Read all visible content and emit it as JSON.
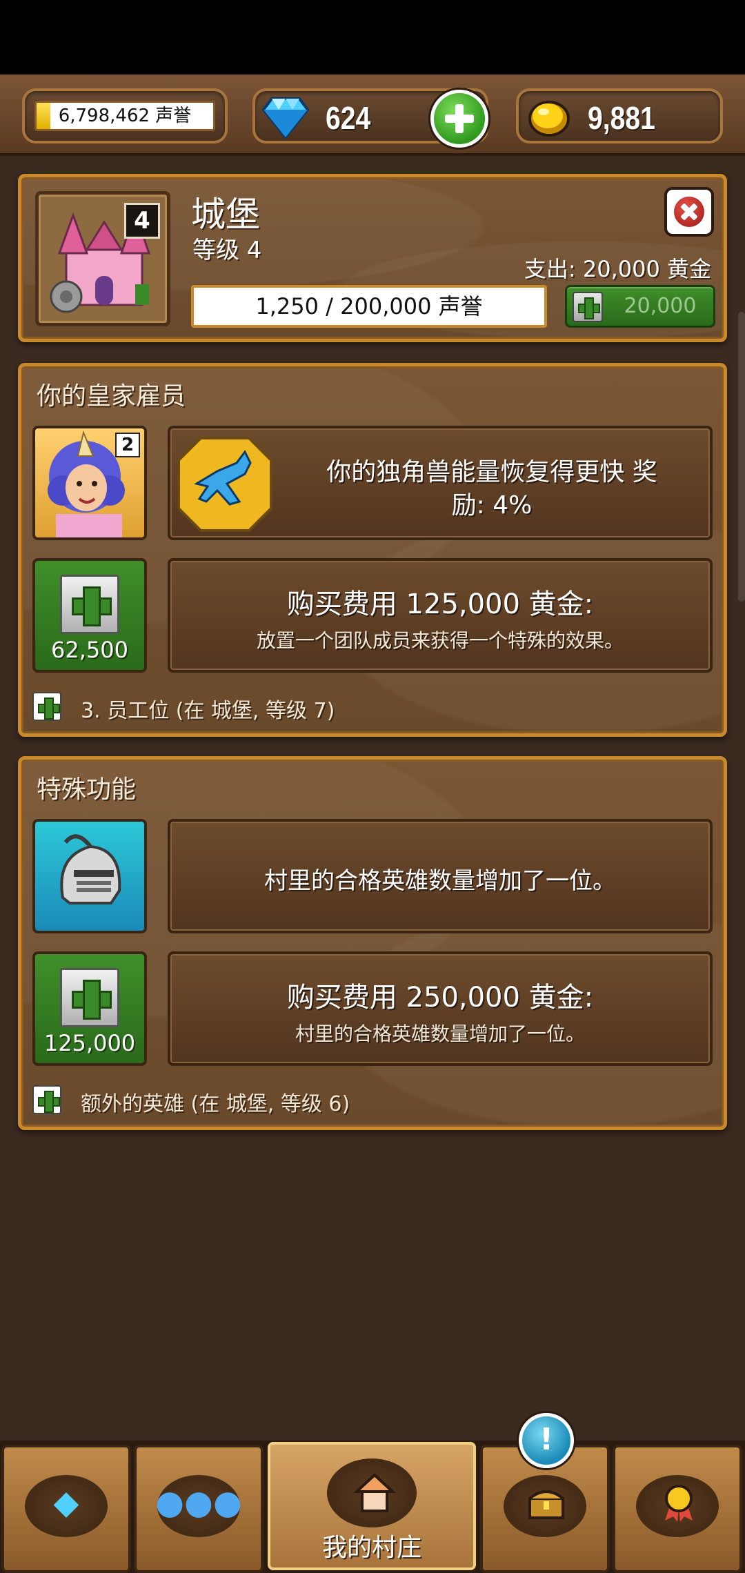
{
  "resources": {
    "reputation_text": "6,798,462 声誉",
    "reputation_fill_fraction": 0.08,
    "gems": "624",
    "gold": "9,881"
  },
  "building": {
    "name": "城堡",
    "level_text": "等级 4",
    "level_badge": "4",
    "cost_text": "支出: 20,000 黄金",
    "progress_text": "1,250 / 200,000 声誉",
    "progress_fraction": 0.00625,
    "upgrade_price": "20,000"
  },
  "staff": {
    "title": "你的皇家雇员",
    "hero_level": "2",
    "bonus_line1": "你的独角兽能量恢复得更快 奖",
    "bonus_line2": "励: 4%",
    "buy_price": "62,500",
    "buy_line1": "购买费用 125,000 黄金:",
    "buy_line2": "放置一个团队成员来获得一个特殊的效果。",
    "footer": "3. 员工位 (在 城堡, 等级 7)"
  },
  "special": {
    "title": "特殊功能",
    "feature_text": "村里的合格英雄数量增加了一位。",
    "buy_price": "125,000",
    "buy_line1": "购买费用 250,000 黄金:",
    "buy_line2": "村里的合格英雄数量增加了一位。",
    "footer": "额外的英雄 (在 城堡, 等级 6)"
  },
  "nav": {
    "items": [
      {
        "icon": "gem-icon",
        "label": ""
      },
      {
        "icon": "people-icon",
        "label": ""
      },
      {
        "icon": "house-icon",
        "label": "我的村庄"
      },
      {
        "icon": "chest-icon",
        "label": ""
      },
      {
        "icon": "medal-icon",
        "label": ""
      }
    ],
    "notify_symbol": "!"
  },
  "colors": {
    "panel_border": "#c98a2c",
    "green": "#2f8a22",
    "background": "#3a2a20"
  }
}
